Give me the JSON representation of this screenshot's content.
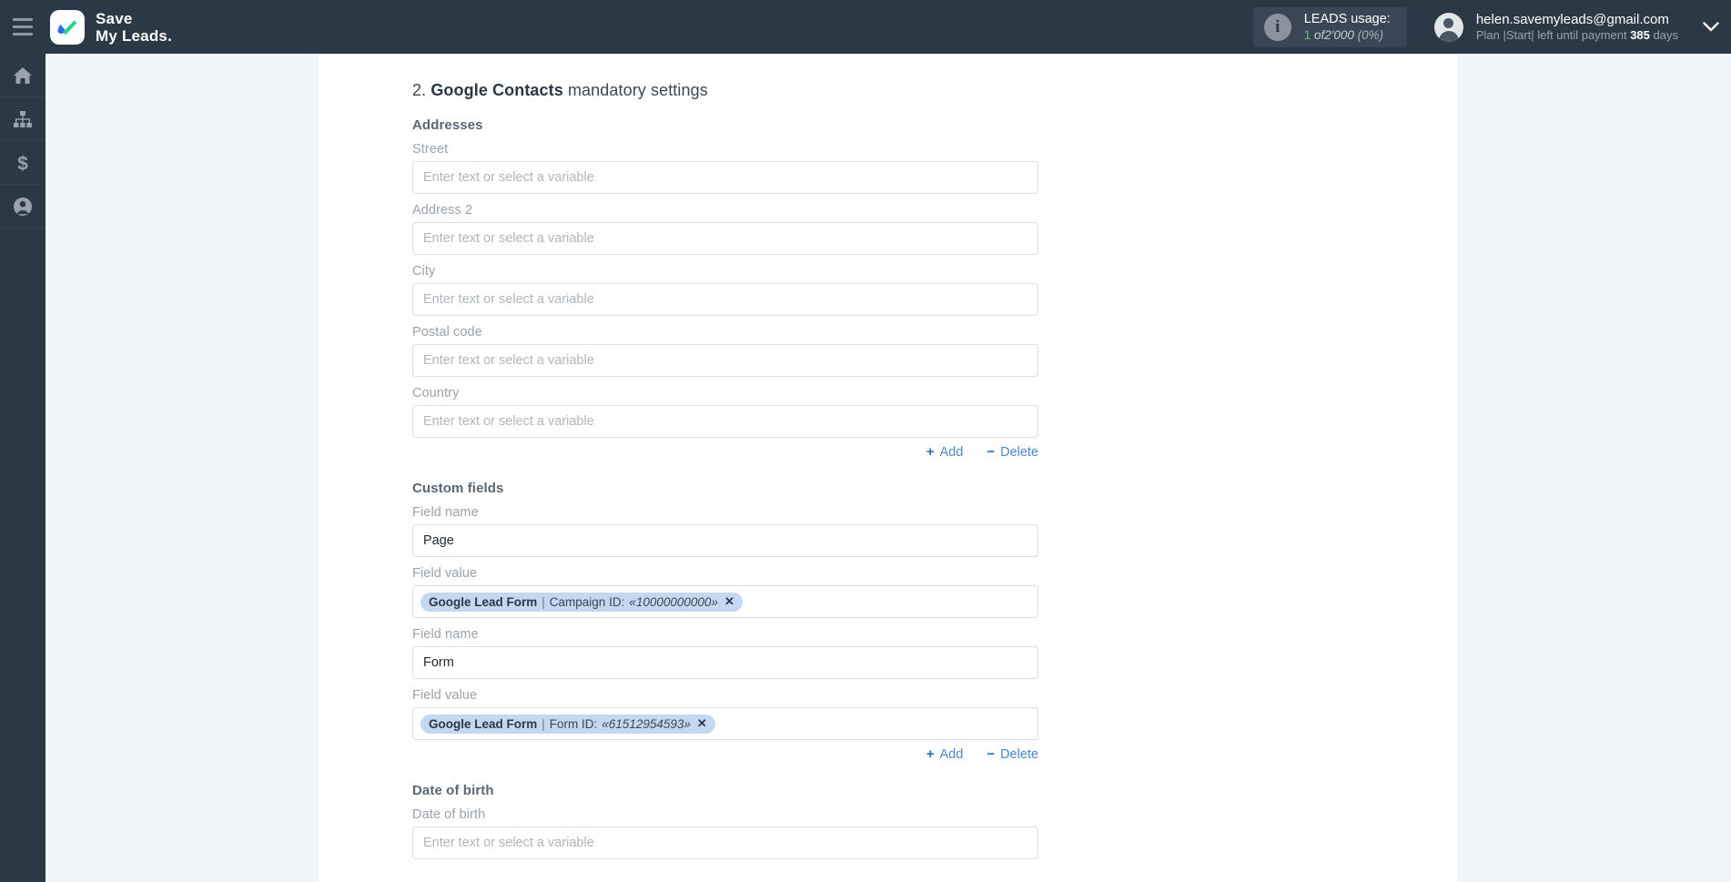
{
  "topbar": {
    "menu_icon": "hamburger-icon",
    "brand_line1": "Save",
    "brand_line2": "My Leads.",
    "leads_usage": {
      "info_icon": "info-icon",
      "title": "LEADS usage:",
      "used": "1",
      "of": "of",
      "total": "2'000",
      "percent": "(0%)"
    },
    "account": {
      "avatar_icon": "user-avatar-icon",
      "email": "helen.savemyleads@gmail.com",
      "plan_prefix": "Plan |Start| left until payment",
      "plan_days": "385",
      "plan_suffix": "days",
      "chevron_icon": "chevron-down-icon"
    }
  },
  "sidebar": {
    "items": [
      {
        "icon": "home-icon",
        "name": "sidebar-item-home"
      },
      {
        "icon": "sitemap-icon",
        "name": "sidebar-item-connections"
      },
      {
        "icon": "dollar-icon",
        "name": "sidebar-item-billing"
      },
      {
        "icon": "user-circle-icon",
        "name": "sidebar-item-profile"
      }
    ]
  },
  "main": {
    "heading_prefix": "2. ",
    "heading_bold": "Google Contacts",
    "heading_suffix": " mandatory settings",
    "placeholder": "Enter text or select a variable",
    "addresses": {
      "group_title": "Addresses",
      "fields": [
        {
          "label": "Street",
          "value": ""
        },
        {
          "label": "Address 2",
          "value": ""
        },
        {
          "label": "City",
          "value": ""
        },
        {
          "label": "Postal code",
          "value": ""
        },
        {
          "label": "Country",
          "value": ""
        }
      ],
      "add_label": "Add",
      "delete_label": "Delete"
    },
    "custom_fields": {
      "group_title": "Custom fields",
      "rows": [
        {
          "name_label": "Field name",
          "name_value": "Page",
          "value_label": "Field value",
          "chip": {
            "source": "Google Lead Form",
            "separator": "|",
            "key": "Campaign ID:",
            "id": "«10000000000»",
            "remove_icon": "close-icon"
          }
        },
        {
          "name_label": "Field name",
          "name_value": "Form",
          "value_label": "Field value",
          "chip": {
            "source": "Google Lead Form",
            "separator": "|",
            "key": "Form ID:",
            "id": "«61512954593»",
            "remove_icon": "close-icon"
          }
        }
      ],
      "add_label": "Add",
      "delete_label": "Delete"
    },
    "date_of_birth": {
      "group_title": "Date of birth",
      "field_label": "Date of birth",
      "value": ""
    },
    "add_symbol": "+",
    "delete_symbol": "−"
  },
  "colors": {
    "topbar_bg": "#2b3846",
    "page_bg": "#f2f5fa",
    "card_bg": "#ffffff",
    "accent_link": "#4a88c7",
    "chip_bg": "#c5d8f2",
    "usage_green": "#63c363"
  }
}
